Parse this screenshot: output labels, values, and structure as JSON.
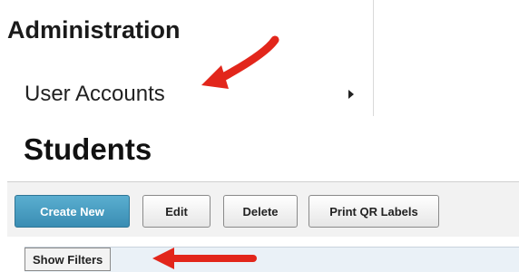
{
  "admin": {
    "title": "Administration",
    "menu_item": "User Accounts"
  },
  "page": {
    "title": "Students"
  },
  "toolbar": {
    "create_new": "Create New",
    "edit": "Edit",
    "delete": "Delete",
    "print_qr": "Print QR Labels"
  },
  "filters": {
    "show_filters": "Show Filters"
  },
  "icons": {
    "submenu": "caret-right-icon",
    "annotation": "red-arrow-icon"
  },
  "colors": {
    "primary_button": "#3a8db3",
    "annotation_arrow": "#e2261b",
    "filter_bar": "#eaf1f7"
  }
}
